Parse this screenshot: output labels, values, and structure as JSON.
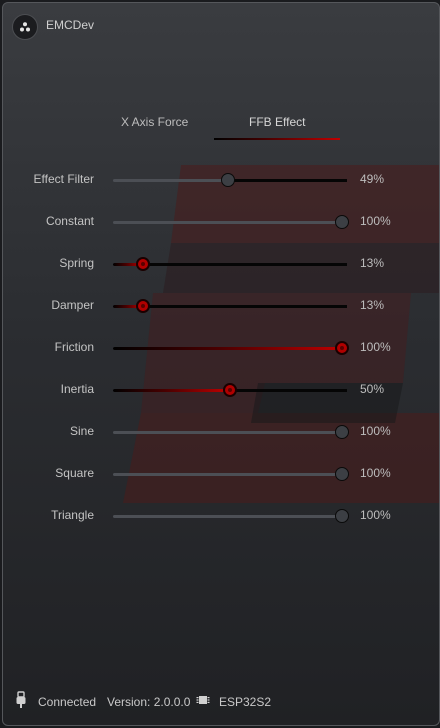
{
  "app": {
    "title": "EMCDev"
  },
  "tabs": [
    {
      "label": "X Axis Force",
      "active": false
    },
    {
      "label": "FFB Effect",
      "active": true
    }
  ],
  "effects": [
    {
      "label": "Effect Filter",
      "value": 49,
      "value_text": "49%",
      "style": "gray"
    },
    {
      "label": "Constant",
      "value": 100,
      "value_text": "100%",
      "style": "gray"
    },
    {
      "label": "Spring",
      "value": 13,
      "value_text": "13%",
      "style": "red"
    },
    {
      "label": "Damper",
      "value": 13,
      "value_text": "13%",
      "style": "red"
    },
    {
      "label": "Friction",
      "value": 100,
      "value_text": "100%",
      "style": "red"
    },
    {
      "label": "Inertia",
      "value": 50,
      "value_text": "50%",
      "style": "red"
    },
    {
      "label": "Sine",
      "value": 100,
      "value_text": "100%",
      "style": "gray"
    },
    {
      "label": "Square",
      "value": 100,
      "value_text": "100%",
      "style": "gray"
    },
    {
      "label": "Triangle",
      "value": 100,
      "value_text": "100%",
      "style": "gray"
    }
  ],
  "status": {
    "connection": "Connected",
    "version": "Version: 2.0.0.0",
    "board": "ESP32S2",
    "connection_icon": "usb-plug-icon",
    "board_icon": "chip-icon"
  },
  "colors": {
    "accent": "#c20000",
    "knob_gray": "#3c3f44",
    "track": "#4c4f55",
    "background": "#2b2d31"
  }
}
